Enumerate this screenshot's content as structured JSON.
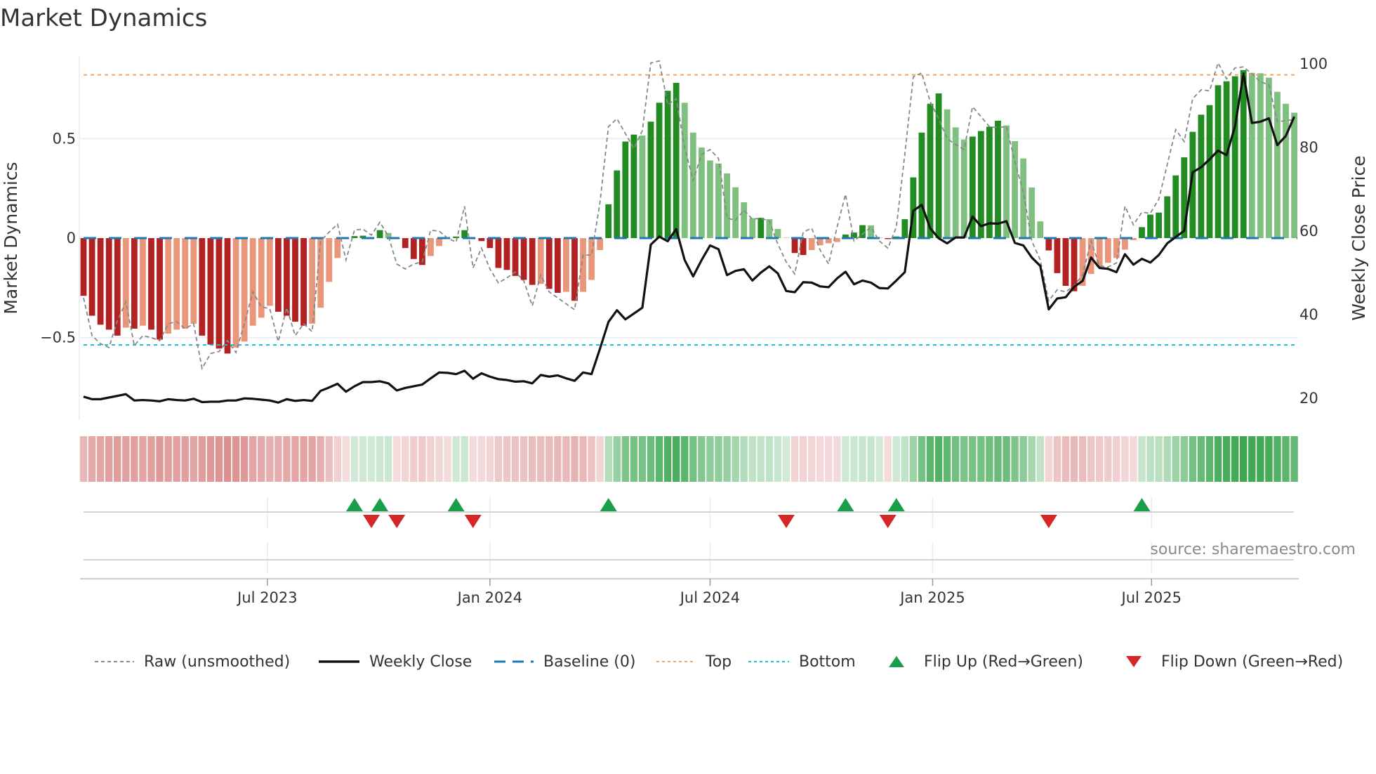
{
  "title": "Market Dynamics",
  "source": "source: sharemaestro.com",
  "chart_data": {
    "type": "bar",
    "title": "Market Dynamics",
    "left_axis": {
      "label": "Market Dynamics",
      "ylim": [
        -0.914,
        0.91
      ],
      "ticks": [
        {
          "value": 0.5,
          "label": "0.5"
        },
        {
          "value": 0,
          "label": "0"
        },
        {
          "value": -0.5,
          "label": "−0.5"
        }
      ]
    },
    "right_axis": {
      "label": "Weekly Close Price",
      "ylim": [
        14.6,
        101.5
      ],
      "ticks": [
        {
          "value": 100,
          "label": "100"
        },
        {
          "value": 80,
          "label": "80"
        },
        {
          "value": 60,
          "label": "60"
        },
        {
          "value": 40,
          "label": "40"
        },
        {
          "value": 20,
          "label": "20"
        }
      ]
    },
    "x_axis": {
      "start_date": "2023-01-30",
      "frequency": "weekly",
      "ticks": [
        {
          "date": "2023-07-01",
          "label": "Jul 2023"
        },
        {
          "date": "2024-01-01",
          "label": "Jan 2024"
        },
        {
          "date": "2024-07-01",
          "label": "Jul 2024"
        },
        {
          "date": "2025-01-01",
          "label": "Jan 2025"
        },
        {
          "date": "2025-07-01",
          "label": "Jul 2025"
        }
      ]
    },
    "levels": {
      "top": 0.82,
      "bottom": -0.537,
      "baseline": 0
    },
    "colors": {
      "up_strong": "#228b22",
      "up_weak": "#7fbf7f",
      "down_strong": "#b22222",
      "down_weak": "#e9967a",
      "top": "#f4a460",
      "bottom": "#17becf",
      "baseline": "#1f77b4",
      "raw": "#888888",
      "close": "#111111",
      "flip_up": "#1a9e4a",
      "flip_down": "#d62728"
    },
    "dynamics": [
      -0.29,
      -0.39,
      -0.435,
      -0.46,
      -0.49,
      -0.45,
      -0.455,
      -0.44,
      -0.46,
      -0.51,
      -0.48,
      -0.46,
      -0.455,
      -0.43,
      -0.49,
      -0.535,
      -0.555,
      -0.58,
      -0.55,
      -0.52,
      -0.44,
      -0.4,
      -0.34,
      -0.37,
      -0.39,
      -0.42,
      -0.44,
      -0.43,
      -0.35,
      -0.22,
      -0.1,
      -0.005,
      0.01,
      0.012,
      0.003,
      0.04,
      0.026,
      -0.003,
      -0.05,
      -0.105,
      -0.135,
      -0.09,
      -0.04,
      -0.002,
      0.008,
      0.04,
      -0.002,
      -0.015,
      -0.05,
      -0.15,
      -0.16,
      -0.19,
      -0.21,
      -0.235,
      -0.23,
      -0.255,
      -0.275,
      -0.27,
      -0.315,
      -0.27,
      -0.21,
      -0.06,
      0.17,
      0.34,
      0.485,
      0.52,
      0.515,
      0.585,
      0.68,
      0.74,
      0.78,
      0.68,
      0.53,
      0.455,
      0.39,
      0.375,
      0.325,
      0.255,
      0.18,
      0.1,
      0.102,
      0.095,
      0.046,
      0.002,
      -0.075,
      -0.085,
      -0.06,
      -0.036,
      -0.026,
      -0.02,
      0.018,
      0.028,
      0.065,
      0.064,
      0.002,
      -0.005,
      0.008,
      0.095,
      0.305,
      0.53,
      0.675,
      0.727,
      0.647,
      0.556,
      0.495,
      0.51,
      0.538,
      0.56,
      0.59,
      0.566,
      0.487,
      0.4,
      0.254,
      0.084,
      -0.062,
      -0.176,
      -0.24,
      -0.267,
      -0.24,
      -0.18,
      -0.145,
      -0.124,
      -0.1,
      -0.058,
      -0.01,
      0.055,
      0.118,
      0.128,
      0.21,
      0.315,
      0.406,
      0.534,
      0.62,
      0.668,
      0.768,
      0.788,
      0.813,
      0.844,
      0.83,
      0.828,
      0.806,
      0.735,
      0.675,
      0.63
    ],
    "raw": [
      -0.3,
      -0.49,
      -0.53,
      -0.55,
      -0.415,
      -0.32,
      -0.54,
      -0.49,
      -0.5,
      -0.515,
      -0.43,
      -0.42,
      -0.455,
      -0.43,
      -0.655,
      -0.58,
      -0.57,
      -0.515,
      -0.575,
      -0.43,
      -0.27,
      -0.345,
      -0.355,
      -0.52,
      -0.35,
      -0.49,
      -0.43,
      -0.47,
      -0.015,
      0.03,
      0.07,
      -0.11,
      0.04,
      0.045,
      0.015,
      0.08,
      0.01,
      -0.13,
      -0.155,
      -0.13,
      -0.12,
      0.04,
      0.035,
      0.0,
      -0.02,
      0.16,
      -0.15,
      -0.05,
      -0.155,
      -0.225,
      -0.2,
      -0.17,
      -0.215,
      -0.34,
      -0.185,
      -0.27,
      -0.3,
      -0.33,
      -0.36,
      -0.085,
      -0.085,
      0.18,
      0.56,
      0.6,
      0.525,
      0.45,
      0.54,
      0.88,
      0.89,
      0.67,
      0.7,
      0.455,
      0.29,
      0.42,
      0.445,
      0.4,
      0.1,
      0.09,
      0.14,
      0.095,
      0.1,
      0.085,
      -0.03,
      -0.12,
      -0.18,
      0.03,
      0.05,
      -0.06,
      -0.13,
      0.055,
      0.22,
      -0.015,
      0.02,
      0.055,
      -0.015,
      -0.05,
      0.055,
      0.42,
      0.81,
      0.83,
      0.685,
      0.6,
      0.5,
      0.47,
      0.445,
      0.66,
      0.61,
      0.56,
      0.555,
      0.56,
      0.385,
      0.23,
      -0.015,
      -0.11,
      -0.315,
      -0.26,
      -0.27,
      -0.24,
      -0.185,
      -0.015,
      -0.14,
      -0.145,
      -0.125,
      0.16,
      0.067,
      0.13,
      0.125,
      0.195,
      0.37,
      0.545,
      0.485,
      0.7,
      0.745,
      0.74,
      0.88,
      0.8,
      0.855,
      0.86,
      0.825,
      0.785,
      0.77,
      0.585,
      0.59,
      0.595
    ],
    "close": [
      20.2,
      19.6,
      19.6,
      20.0,
      20.4,
      20.8,
      19.3,
      19.4,
      19.3,
      19.1,
      19.6,
      19.4,
      19.3,
      19.7,
      18.9,
      19.0,
      19.0,
      19.3,
      19.3,
      19.8,
      19.7,
      19.5,
      19.3,
      18.8,
      19.6,
      19.2,
      19.4,
      19.2,
      21.6,
      22.4,
      23.3,
      21.4,
      22.7,
      23.7,
      23.7,
      23.9,
      23.4,
      21.7,
      22.3,
      22.7,
      23.1,
      24.6,
      26.0,
      25.9,
      25.6,
      26.4,
      24.5,
      25.8,
      25.0,
      24.4,
      24.2,
      23.8,
      23.9,
      23.4,
      25.4,
      25.0,
      25.3,
      24.6,
      24.0,
      26.0,
      25.6,
      31.7,
      38.1,
      40.9,
      38.7,
      40.1,
      41.5,
      56.6,
      58.5,
      57.4,
      60.3,
      52.9,
      49.0,
      52.9,
      56.4,
      55.5,
      49.3,
      50.3,
      50.7,
      48.0,
      49.9,
      51.4,
      49.7,
      45.5,
      45.2,
      47.6,
      47.5,
      46.6,
      46.4,
      48.5,
      50.1,
      47.1,
      48.0,
      47.5,
      46.2,
      46.1,
      48.0,
      50.0,
      64.7,
      66.1,
      60.5,
      58.1,
      56.9,
      58.3,
      58.3,
      63.3,
      61.0,
      61.7,
      61.6,
      62.2,
      57.0,
      56.4,
      53.5,
      51.5,
      41.1,
      43.7,
      44.0,
      46.5,
      47.9,
      53.5,
      51.0,
      50.8,
      50.0,
      54.3,
      51.8,
      53.2,
      52.3,
      54.1,
      56.9,
      58.4,
      59.9,
      73.9,
      75.1,
      77.0,
      79.1,
      78.0,
      84.9,
      97.5,
      85.7,
      86.0,
      86.8,
      80.4,
      82.6,
      87.2
    ],
    "flip_up_weeks": [
      32,
      35,
      44,
      62,
      90,
      96,
      125
    ],
    "flip_down_weeks": [
      34,
      37,
      46,
      83,
      95,
      114
    ],
    "legend": [
      {
        "label": "Raw (unsmoothed)",
        "symbol": "dashed-gray"
      },
      {
        "label": "Weekly Close",
        "symbol": "solid-black"
      },
      {
        "label": "Baseline (0)",
        "symbol": "dashed-blue"
      },
      {
        "label": "Top",
        "symbol": "dotted-orange"
      },
      {
        "label": "Bottom",
        "symbol": "dotted-cyan"
      },
      {
        "label": "Flip Up (Red→Green)",
        "symbol": "triangle-up-green"
      },
      {
        "label": "Flip Down (Green→Red)",
        "symbol": "triangle-down-red"
      }
    ],
    "legend_position": "bottom"
  }
}
